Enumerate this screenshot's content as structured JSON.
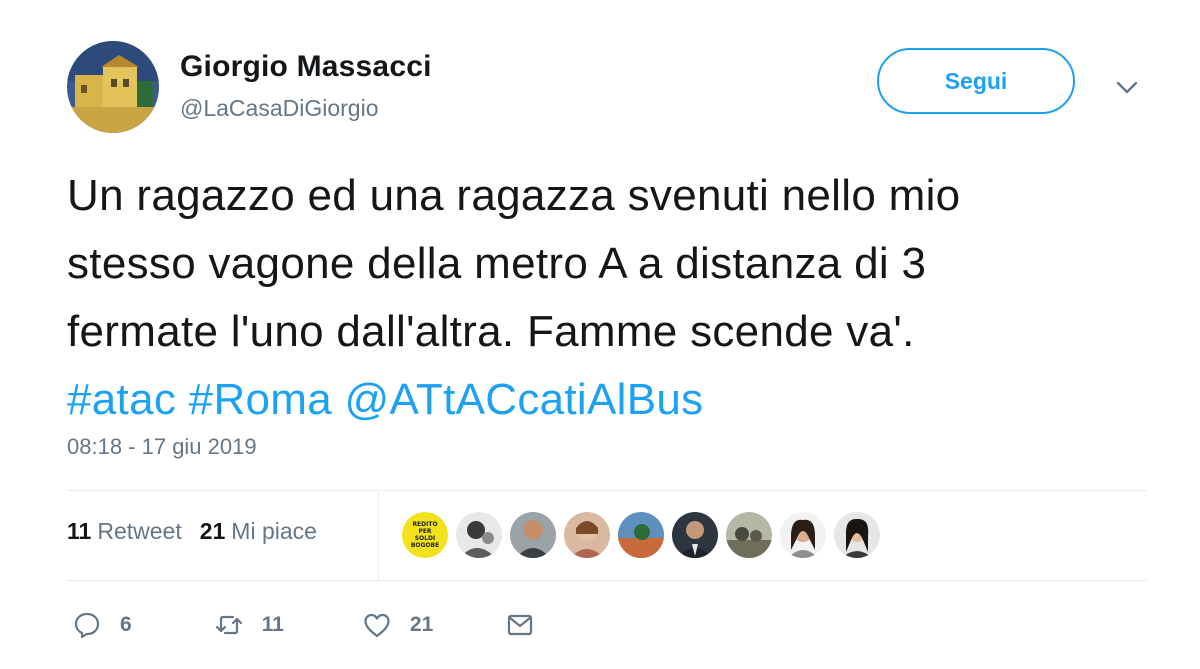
{
  "user": {
    "display_name": "Giorgio Massacci",
    "handle": "@LaCasaDiGiorgio",
    "avatar_icon": "house-painting-avatar"
  },
  "follow_button": {
    "label": "Segui"
  },
  "menu": {
    "icon": "chevron-down-icon"
  },
  "tweet": {
    "lines": [
      "Un ragazzo ed una ragazza svenuti nello mio",
      "stesso vagone della metro A a distanza di 3",
      "fermate l'uno dall'altra. Famme scende va'."
    ],
    "links": [
      "#atac",
      "#Roma",
      "@ATtACcatiAlBus"
    ]
  },
  "timestamp": "08:18 - 17 giu 2019",
  "stats": {
    "retweets_count": "11",
    "retweets_label": "Retweet",
    "likes_count": "21",
    "likes_label": "Mi piace"
  },
  "likers": [
    {
      "name": "liker-avatar-1",
      "icon": "yellow-badge-avatar",
      "badge_text": [
        "REDITO",
        "PER",
        "SOLDI",
        "BOGOBE"
      ]
    },
    {
      "name": "liker-avatar-2",
      "icon": "person-avatar"
    },
    {
      "name": "liker-avatar-3",
      "icon": "person-avatar"
    },
    {
      "name": "liker-avatar-4",
      "icon": "person-avatar"
    },
    {
      "name": "liker-avatar-5",
      "icon": "landscape-avatar"
    },
    {
      "name": "liker-avatar-6",
      "icon": "person-avatar"
    },
    {
      "name": "liker-avatar-7",
      "icon": "landscape-avatar"
    },
    {
      "name": "liker-avatar-8",
      "icon": "person-avatar"
    },
    {
      "name": "liker-avatar-9",
      "icon": "person-avatar"
    }
  ],
  "actions": {
    "reply_count": "6",
    "retweet_count": "11",
    "like_count": "21"
  },
  "colors": {
    "accent": "#1da1f2",
    "text": "#14171a",
    "muted": "#657786",
    "divider": "#e6ecf0"
  }
}
